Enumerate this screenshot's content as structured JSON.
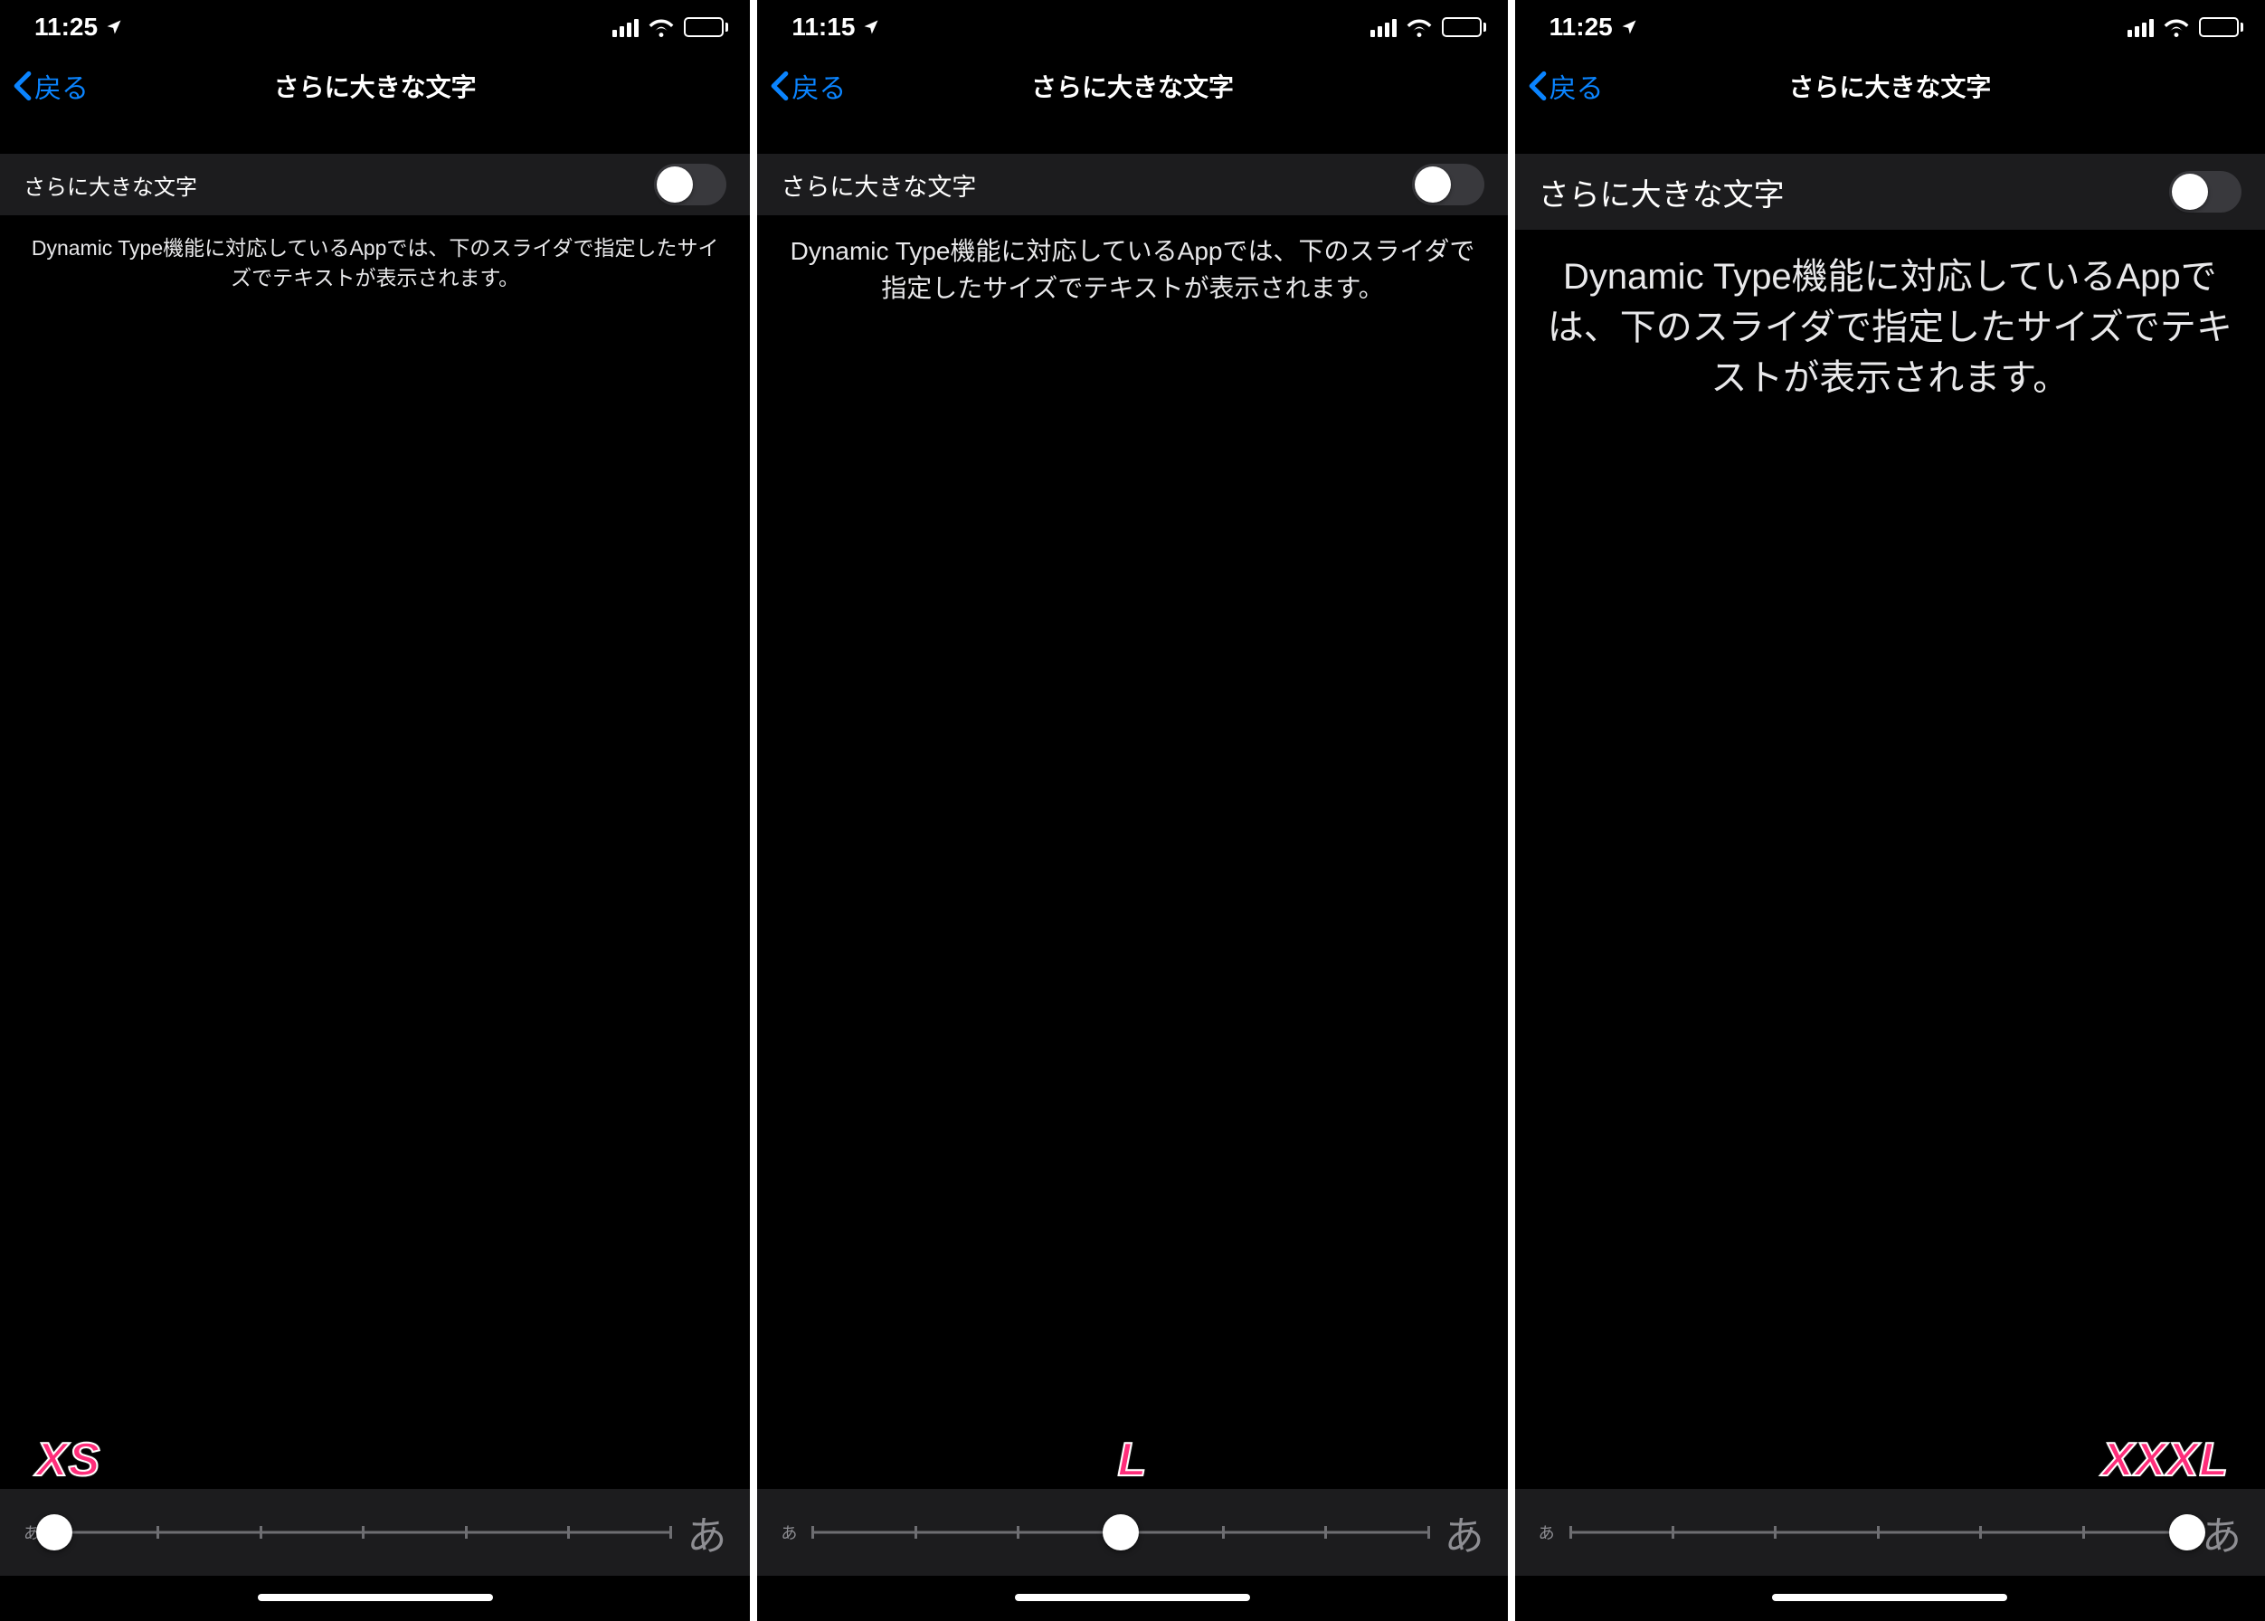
{
  "screens": [
    {
      "status_time": "11:25",
      "nav_back": "戻る",
      "nav_title": "さらに大きな文字",
      "switch_label": "さらに大きな文字",
      "switch_on": false,
      "description": "Dynamic Type機能に対応しているAppでは、下のスライダで指定したサイズでテキストが表示されます。",
      "size_badge": "XS",
      "slider": {
        "steps": 7,
        "position": 0,
        "small_glyph": "あ",
        "large_glyph": "あ"
      }
    },
    {
      "status_time": "11:15",
      "nav_back": "戻る",
      "nav_title": "さらに大きな文字",
      "switch_label": "さらに大きな文字",
      "switch_on": false,
      "description": "Dynamic Type機能に対応しているAppでは、下のスライダで指定したサイズでテキストが表示されます。",
      "size_badge": "L",
      "slider": {
        "steps": 7,
        "position": 3,
        "small_glyph": "あ",
        "large_glyph": "あ"
      }
    },
    {
      "status_time": "11:25",
      "nav_back": "戻る",
      "nav_title": "さらに大きな文字",
      "switch_label": "さらに大きな文字",
      "switch_on": false,
      "description": "Dynamic Type機能に対応しているAppでは、下のスライダで指定したサイズでテキストが表示されます。",
      "size_badge": "XXXL",
      "slider": {
        "steps": 7,
        "position": 6,
        "small_glyph": "あ",
        "large_glyph": "あ"
      }
    }
  ]
}
